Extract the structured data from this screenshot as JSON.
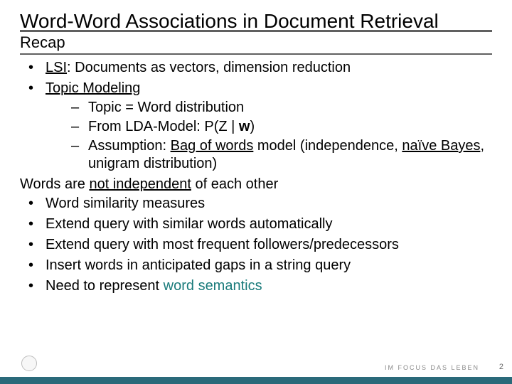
{
  "title": "Word-Word Associations in Document Retrieval",
  "subtitle": "Recap",
  "bullet1_pre": "LSI",
  "bullet1_post": ": Documents as vectors, dimension reduction",
  "bullet2": "Topic Modeling",
  "sub1": "Topic = Word distribution",
  "sub2_a": "From LDA-Model: P(Z | ",
  "sub2_b": "w",
  "sub2_c": ")",
  "sub3_a": "Assumption: ",
  "sub3_b": "Bag of words",
  "sub3_c": " model (independence, ",
  "sub3_d": "naïve Bayes",
  "sub3_e": ", unigram distribution)",
  "stmt_a": "Words are ",
  "stmt_b": "not independent",
  "stmt_c": " of each other",
  "b3": "Word similarity measures",
  "b4": "Extend query with similar words automatically",
  "b5": "Extend query with most frequent followers/predecessors",
  "b6": "Insert words in anticipated gaps in a string query",
  "b7_a": "Need to represent ",
  "b7_b": "word semantics",
  "footer_brand": "IM FOCUS DAS LEBEN",
  "page": "2"
}
